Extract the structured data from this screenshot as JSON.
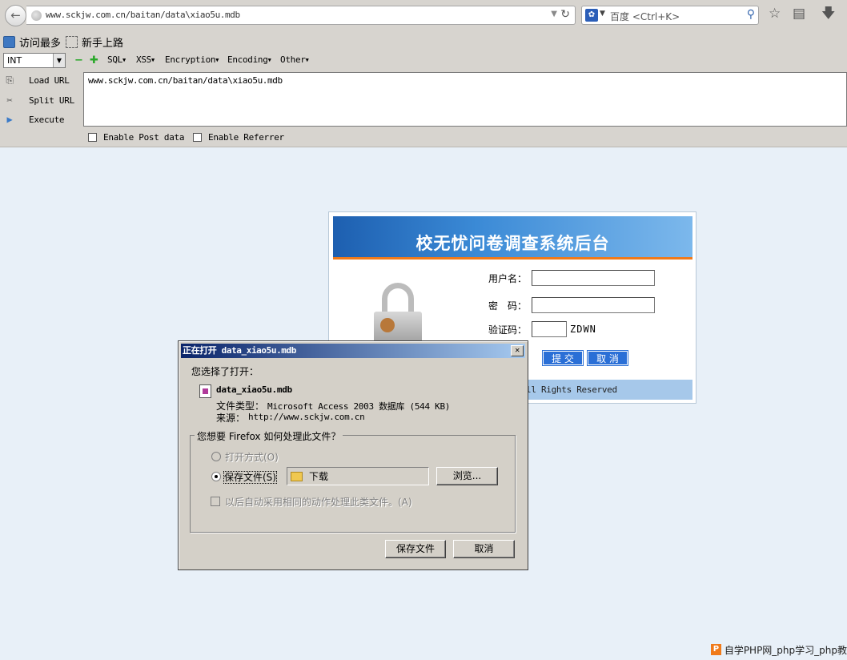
{
  "browser": {
    "url": "www.sckjw.com.cn/baitan/data\\xiao5u.mdb",
    "search_placeholder": "百度 <Ctrl+K>",
    "search_engine_icon": "baidu-paw-icon"
  },
  "bookmarks": [
    {
      "label": "访问最多",
      "icon": "most-visited-icon"
    },
    {
      "label": "新手上路",
      "icon": "getting-started-icon"
    }
  ],
  "hackbar": {
    "select_value": "INT",
    "menus": [
      "SQL",
      "XSS",
      "Encryption",
      "Encoding",
      "Other"
    ],
    "actions": [
      "Load URL",
      "Split URL",
      "Execute"
    ],
    "url_text": "www.sckjw.com.cn/baitan/data\\xiao5u.mdb",
    "checkboxes": [
      "Enable Post data",
      "Enable Referrer"
    ]
  },
  "login": {
    "title": "校无忧问卷调查系统后台",
    "username_label": "用户名：",
    "password_label": "密　码：",
    "captcha_label": "验证码：",
    "captcha_code": "ZDWN",
    "submit_label": "提 交",
    "cancel_label": "取 消",
    "footer": "ll Rights Reserved"
  },
  "dialog": {
    "title": "正在打开 data_xiao5u.mdb",
    "intro": "您选择了打开：",
    "filename": "data_xiao5u.mdb",
    "filetype_label": "文件类型：",
    "filetype": "Microsoft Access 2003 数据库 (544 KB)",
    "source_label": "来源：",
    "source": "http://www.sckjw.com.cn",
    "question": "您想要 Firefox 如何处理此文件？",
    "open_with": "打开方式(O)",
    "save_file_option": "保存文件(S)",
    "folder": "下载",
    "browse": "浏览...",
    "auto_check": "以后自动采用相同的动作处理此类文件。(A)",
    "save_button": "保存文件",
    "cancel_button": "取消"
  },
  "watermark": "自学PHP网_php学习_php教"
}
